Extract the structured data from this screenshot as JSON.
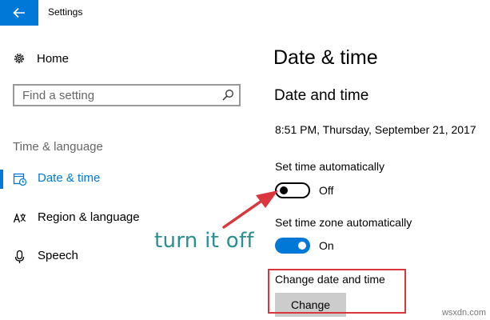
{
  "window": {
    "title": "Settings"
  },
  "nav": {
    "home_label": "Home",
    "search_placeholder": "Find a setting",
    "section_label": "Time & language",
    "items": [
      {
        "label": "Date & time",
        "icon": "calendar-clock-icon",
        "selected": true
      },
      {
        "label": "Region & language",
        "icon": "region-language-icon",
        "selected": false
      },
      {
        "label": "Speech",
        "icon": "microphone-icon",
        "selected": false
      }
    ]
  },
  "main": {
    "page_title": "Date & time",
    "sub_title": "Date and time",
    "current_time": "8:51 PM, Thursday, September 21, 2017",
    "set_time_auto": {
      "label": "Set time automatically",
      "state": "Off",
      "on": false
    },
    "set_timezone_auto": {
      "label": "Set time zone automatically",
      "state": "On",
      "on": true
    },
    "change_section_label": "Change date and time",
    "change_button_label": "Change"
  },
  "annotation": {
    "text": "turn it off"
  },
  "watermark": "wsxdn.com",
  "colors": {
    "accent": "#0078d7",
    "annotation_text": "#2a8f8f",
    "annotation_red": "#d9363e",
    "button_bg": "#cccccc"
  }
}
